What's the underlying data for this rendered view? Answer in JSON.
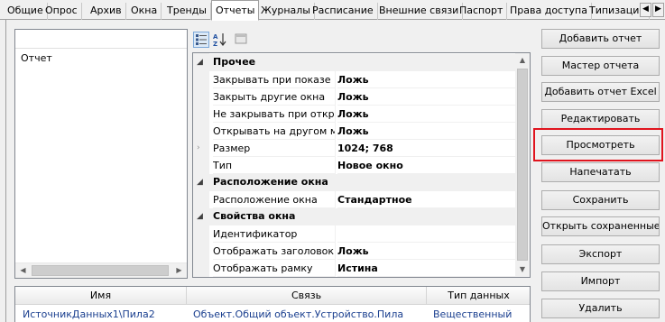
{
  "tabs": {
    "items": [
      "Общие",
      "Опрос",
      "Архив",
      "Окна",
      "Тренды",
      "Отчеты",
      "Журналы",
      "Расписание",
      "Внешние связи",
      "Паспорт",
      "Права доступа",
      "Типизация"
    ],
    "active": "Отчеты",
    "scroll_left_icon": "chevron-left-icon",
    "scroll_right_icon": "chevron-right-icon"
  },
  "report_list": {
    "items": [
      "Отчет"
    ]
  },
  "property_grid": {
    "toolbar_icons": [
      "categorized-icon",
      "sort-alpha-icon",
      "property-pages-icon"
    ],
    "categories": [
      {
        "name": "Прочее",
        "expanded": true,
        "rows": [
          {
            "name": "Закрывать при показе пр",
            "value": "Ложь"
          },
          {
            "name": "Закрыть другие окна",
            "value": "Ложь"
          },
          {
            "name": "Не закрывать при откры",
            "value": "Ложь"
          },
          {
            "name": "Открывать на другом мо",
            "value": "Ложь"
          },
          {
            "name": "Размер",
            "value": "1024; 768",
            "expandable": true
          },
          {
            "name": "Тип",
            "value": "Новое окно"
          }
        ]
      },
      {
        "name": "Расположение окна",
        "expanded": true,
        "rows": [
          {
            "name": "Расположение окна",
            "value": "Стандартное"
          }
        ]
      },
      {
        "name": "Свойства окна",
        "expanded": true,
        "rows": [
          {
            "name": "Идентификатор",
            "value": ""
          },
          {
            "name": "Отображать заголовок",
            "value": "Ложь"
          },
          {
            "name": "Отображать рамку",
            "value": "Истина"
          }
        ]
      }
    ]
  },
  "buttons": {
    "add_report": "Добавить отчет",
    "report_wizard": "Мастер отчета",
    "add_excel_report": "Добавить отчет Excel",
    "edit": "Редактировать",
    "preview": "Просмотреть",
    "print": "Напечатать",
    "save": "Сохранить",
    "open_saved": "Открыть сохраненные",
    "export": "Экспорт",
    "import": "Импорт",
    "delete": "Удалить"
  },
  "sources_table": {
    "columns": [
      "Имя",
      "Связь",
      "Тип данных"
    ],
    "rows": [
      [
        "ИсточникДанных1\\Пила2",
        "Объект.Общий объект.Устройство.Пила",
        "Вещественный"
      ]
    ]
  },
  "colors": {
    "highlight": "#e0141e",
    "link_text": "#1a3f8f"
  }
}
